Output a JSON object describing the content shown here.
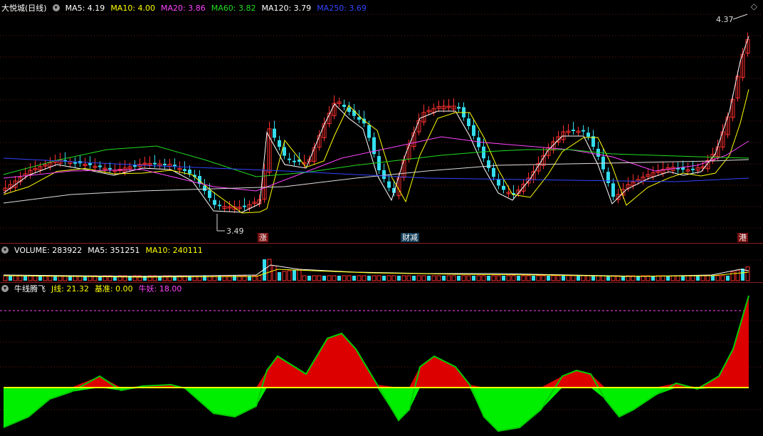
{
  "header": {
    "title": "大悦城(日线)",
    "ma": [
      {
        "label": "MA5: 4.19",
        "color": "#ffffff"
      },
      {
        "label": "MA10: 4.00",
        "color": "#ffff00"
      },
      {
        "label": "MA20: 3.86",
        "color": "#ff44ff"
      },
      {
        "label": "MA60: 3.82",
        "color": "#22dd22"
      },
      {
        "label": "MA120: 3.79",
        "color": "#ffffff"
      },
      {
        "label": "MA250: 3.69",
        "color": "#3344ff"
      }
    ],
    "high_label": "4.37",
    "low_label": "3.49"
  },
  "volume_header": {
    "volume": "VOLUME: 283922",
    "ma5": "MA5: 351251",
    "ma10": "MA10: 240111"
  },
  "indicator_header": {
    "name": "牛线腾飞",
    "j": "J线: 21.32",
    "base": "基准: 0.00",
    "bull": "牛妖: 18.00"
  },
  "tags": {
    "up": "涨",
    "earn": "财减",
    "hk": "港"
  },
  "colors": {
    "up": "#ff3030",
    "down": "#33ddee",
    "bg": "#000000",
    "grid": "#8a1d1d",
    "pos_fill": "#dd0000",
    "neg_fill": "#00ee00"
  }
}
